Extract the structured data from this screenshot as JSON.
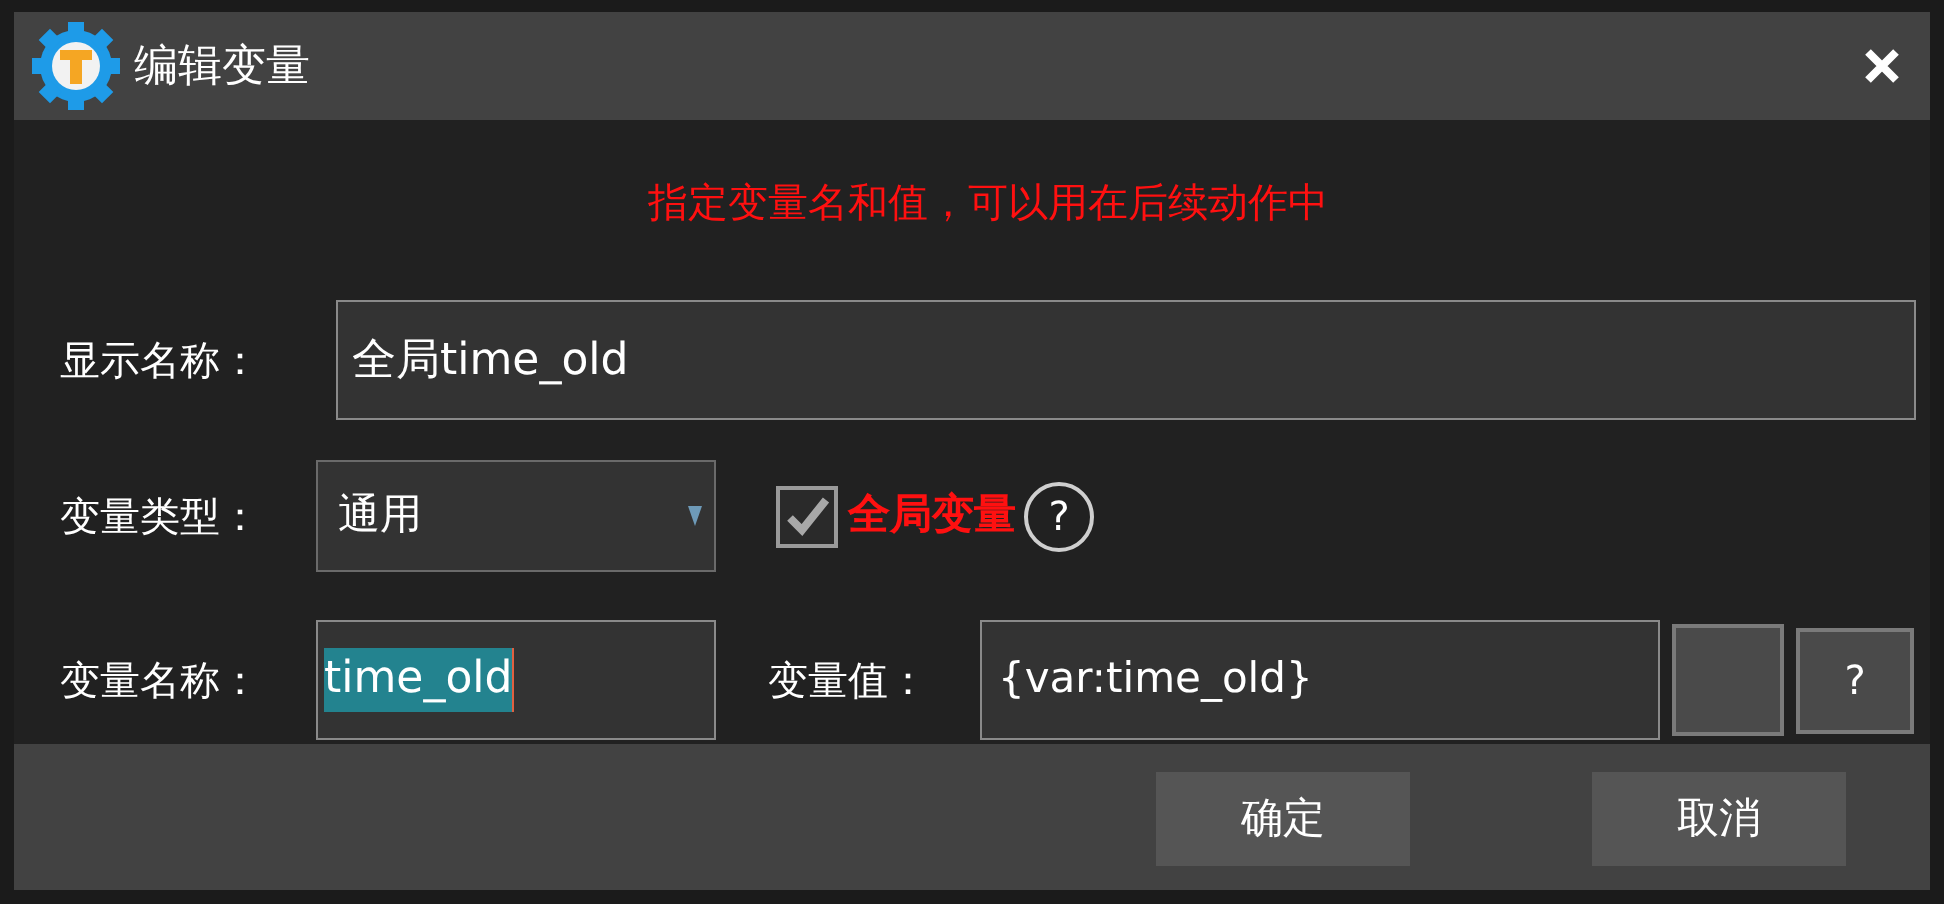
{
  "window": {
    "title": "编辑变量"
  },
  "hint": "指定变量名和值，可以用在后续动作中",
  "display_name": {
    "label": "显示名称：",
    "value": "全局time_old"
  },
  "var_type": {
    "label": "变量类型：",
    "value": "通用"
  },
  "global_var": {
    "label": "全局变量",
    "checked": true,
    "help": "?"
  },
  "var_name": {
    "label": "变量名称：",
    "value": "time_old",
    "text_selected": true
  },
  "var_value": {
    "label": "变量值：",
    "value": "{var:time_old}",
    "help": "?"
  },
  "buttons": [
    {
      "label": "确定"
    },
    {
      "label": "取消"
    }
  ]
}
